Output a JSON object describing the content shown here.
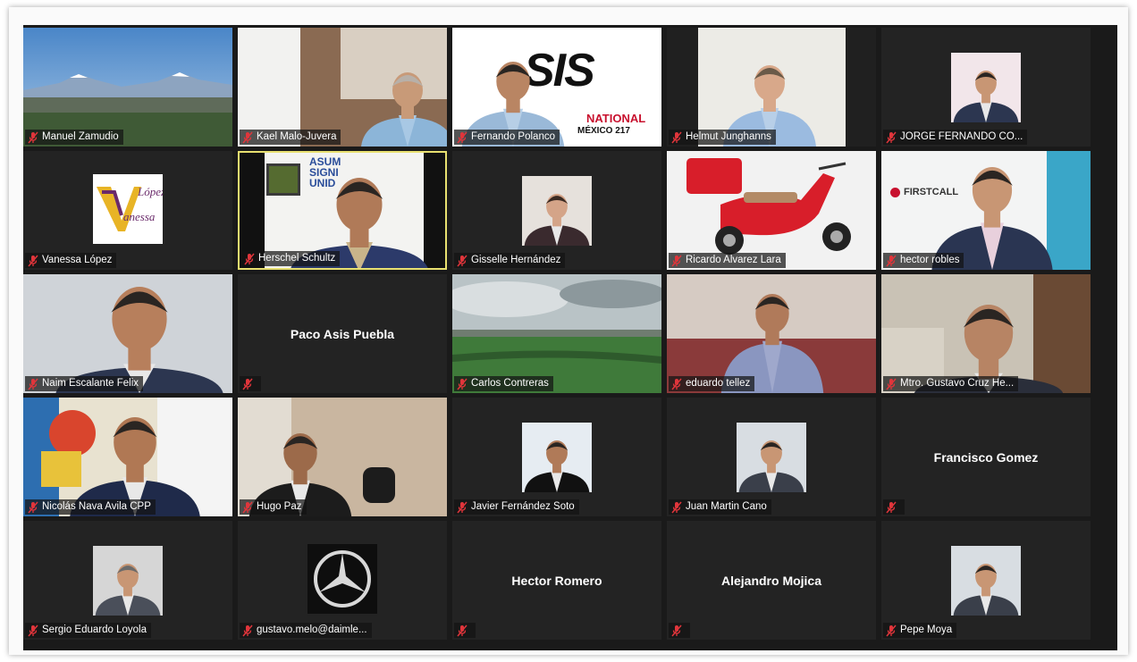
{
  "participants": [
    {
      "name": "Manuel Zamudio",
      "kind": "video",
      "scene": "volcano-city"
    },
    {
      "name": "Kael Malo-Juvera",
      "kind": "video",
      "scene": "office"
    },
    {
      "name": "Fernando Polanco",
      "kind": "video",
      "scene": "asis-logo"
    },
    {
      "name": "Helmut Junghanns",
      "kind": "video",
      "scene": "man-white-wall"
    },
    {
      "name": "JORGE FERNANDO CO...",
      "kind": "photo"
    },
    {
      "name": "Vanessa López",
      "kind": "logo"
    },
    {
      "name": "Herschel Schultz",
      "kind": "video",
      "scene": "speaker",
      "active": true
    },
    {
      "name": "Gisselle Hernández",
      "kind": "photo"
    },
    {
      "name": "Ricardo Alvarez Lara",
      "kind": "video",
      "scene": "scooter"
    },
    {
      "name": "hector robles",
      "kind": "video",
      "scene": "firstcall"
    },
    {
      "name": "Naim Escalante Felix",
      "kind": "video",
      "scene": "portrait"
    },
    {
      "name": "",
      "kind": "name",
      "display": "Paco Asis Puebla"
    },
    {
      "name": "Carlos Contreras",
      "kind": "video",
      "scene": "landscape"
    },
    {
      "name": "eduardo tellez",
      "kind": "video",
      "scene": "sofa"
    },
    {
      "name": "Mtro. Gustavo Cruz He...",
      "kind": "video",
      "scene": "office2"
    },
    {
      "name": "Nicolás Nava Avila CPP",
      "kind": "video",
      "scene": "art"
    },
    {
      "name": "Hugo Paz",
      "kind": "video",
      "scene": "room"
    },
    {
      "name": "Javier Fernández Soto",
      "kind": "photo"
    },
    {
      "name": "Juan Martin Cano",
      "kind": "photo"
    },
    {
      "name": "",
      "kind": "name",
      "display": "Francisco Gomez"
    },
    {
      "name": "Sergio Eduardo Loyola",
      "kind": "photo"
    },
    {
      "name": "gustavo.melo@daimle...",
      "kind": "logo-mb"
    },
    {
      "name": "",
      "kind": "name",
      "display": "Hector Romero"
    },
    {
      "name": "",
      "kind": "name",
      "display": "Alejandro Mojica"
    },
    {
      "name": "Pepe Moya",
      "kind": "photo"
    }
  ],
  "logos": {
    "vanessa_line1": "López",
    "vanessa_line2": "anessa",
    "asis_main": "SIS",
    "asis_sub": "NATIONAL",
    "asis_chapter": "MÉXICO 217",
    "firstcall": "FIRSTCALL",
    "banner_line1": "ASUM",
    "banner_line2": "SIGNI",
    "banner_line3": "UNID"
  },
  "colors": {
    "gallery_bg": "#1a1a1a",
    "tile_bg": "#232323",
    "active_border": "#e8e070",
    "muted_mic": "#e0353b"
  },
  "icons": {
    "muted": "muted-microphone-icon"
  }
}
